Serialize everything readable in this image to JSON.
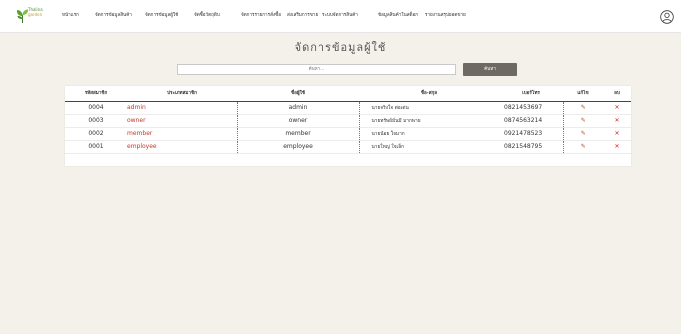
{
  "brand": {
    "line1": "Thalina",
    "line2": "garden"
  },
  "nav": [
    "หน้าแรก",
    "จัดการข้อมูลสินค้า",
    "จัดการข้อมูลผู้ใช้",
    "จัดซื้อวัตถุดิบ",
    "จัดการรายการสั่งซื้อ",
    "ส่งเสริมการขาย",
    "ระบบจัดการสินค้า",
    "ข้อมูลสินค้าในสต็อก",
    "รายงานสรุปยอดขาย"
  ],
  "page": {
    "title": "จัดการข้อมูลผู้ใช้"
  },
  "search": {
    "placeholder": "ค้นหา...",
    "button": "ค้นหา"
  },
  "table": {
    "headers": [
      "รหัสสมาชิก",
      "ประเภทสมาชิก",
      "ชื่อผู้ใช้",
      "ชื่อ-สกุล",
      "เบอร์โทร",
      "แก้ไข",
      "ลบ"
    ],
    "rows": [
      {
        "id": "0004",
        "type": "admin",
        "username": "admin",
        "fullname": "นายจริงใจ ต่อเด่น",
        "phone": "0821453697",
        "edit": "✎",
        "del": "✕"
      },
      {
        "id": "0003",
        "type": "owner",
        "username": "owner",
        "fullname": "นายทรัพย์มั่นมี มากพาย",
        "phone": "0874563214",
        "edit": "✎",
        "del": "✕"
      },
      {
        "id": "0002",
        "type": "member",
        "username": "member",
        "fullname": "นายน้อย ใจมาก",
        "phone": "0921478523",
        "edit": "✎",
        "del": "✕"
      },
      {
        "id": "0001",
        "type": "employee",
        "username": "employee",
        "fullname": "นายใหญ่ ใจเล็ก",
        "phone": "0821548795",
        "edit": "✎",
        "del": "✕"
      }
    ]
  },
  "colors": {
    "accent": "#6e6a62",
    "typeText": "#c0392b",
    "delete": "#e02020",
    "edit": "#b54a2e"
  }
}
